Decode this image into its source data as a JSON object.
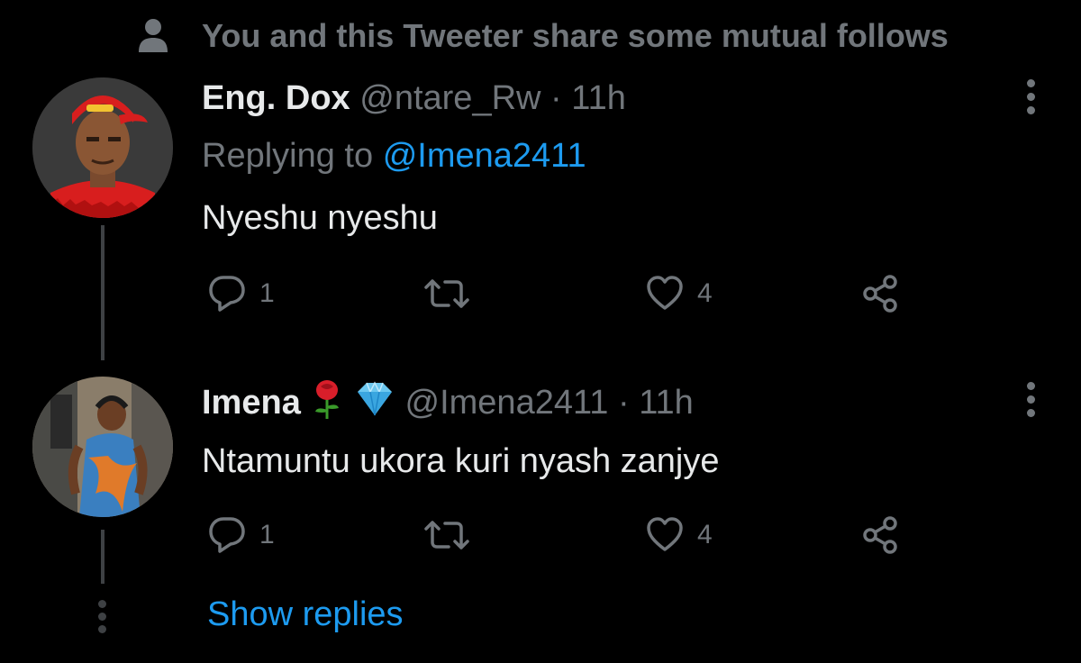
{
  "social_context": {
    "text": "You and this Tweeter share some mutual follows",
    "icon": "person-icon"
  },
  "tweets": [
    {
      "display_name": "Eng. Dox",
      "handle": "@ntare_Rw",
      "separator": "·",
      "time": "11h",
      "replying_prefix": "Replying to",
      "replying_to": "@Imena2411",
      "text": "Nyeshu nyeshu",
      "reply_count": "1",
      "retweet_count": "",
      "like_count": "4"
    },
    {
      "display_name": "Imena",
      "emojis": [
        "rose-emoji",
        "gem-emoji"
      ],
      "handle": "@Imena2411",
      "separator": "·",
      "time": "11h",
      "text": "Ntamuntu ukora kuri nyash zanjye",
      "reply_count": "1",
      "retweet_count": "",
      "like_count": "4"
    }
  ],
  "show_replies": "Show replies",
  "colors": {
    "background": "#000000",
    "primary_text": "#e7e9ea",
    "secondary_text": "#71767b",
    "link": "#1d9bf0",
    "thread_line": "#3e4144"
  }
}
